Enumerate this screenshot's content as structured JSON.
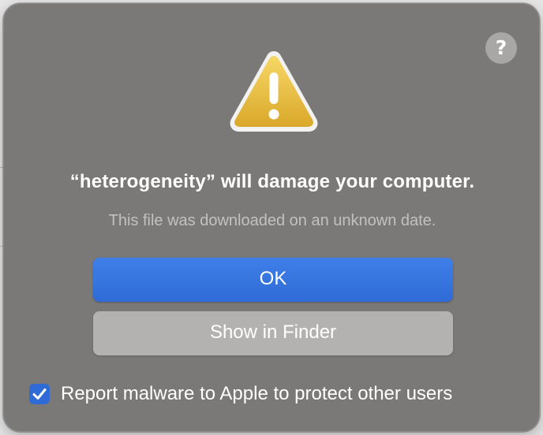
{
  "dialog": {
    "help_label": "?",
    "icon": "warning-triangle-icon",
    "title": "“heterogeneity” will damage your computer.",
    "message": "This file was downloaded on an unknown date.",
    "ok_label": "OK",
    "show_in_finder_label": "Show in Finder",
    "report": {
      "checked": true,
      "label": "Report malware to Apple to protect other users"
    }
  },
  "colors": {
    "dialog_background": "#7b7978",
    "primary_button": "#2f6bd6",
    "secondary_button": "#b4b2b1",
    "warning_yellow": "#f2c744"
  }
}
